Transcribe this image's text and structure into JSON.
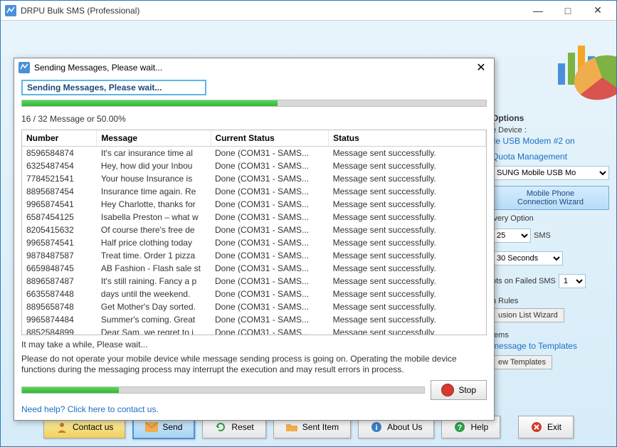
{
  "window": {
    "title": "DRPU Bulk SMS (Professional)",
    "min": "—",
    "max": "□",
    "close": "✕"
  },
  "dialog": {
    "title": "Sending Messages, Please wait...",
    "marquee": "Sending Messages, Please wait...",
    "close": "✕",
    "progress1_pct": "55%",
    "progress_text": "16 / 32 Message or 50.00%",
    "columns": {
      "number": "Number",
      "message": "Message",
      "current": "Current Status",
      "status": "Status"
    },
    "rows": [
      {
        "number": "8596584874",
        "message": "It's car insurance time al",
        "current": "Done (COM31 - SAMS...",
        "status": "Message sent successfully."
      },
      {
        "number": "6325487454",
        "message": "Hey, how did your Inbou",
        "current": "Done (COM31 - SAMS...",
        "status": "Message sent successfully."
      },
      {
        "number": "7784521541",
        "message": "Your house Insurance is",
        "current": "Done (COM31 - SAMS...",
        "status": "Message sent successfully."
      },
      {
        "number": "8895687454",
        "message": "Insurance time again. Re",
        "current": "Done (COM31 - SAMS...",
        "status": "Message sent successfully."
      },
      {
        "number": "9965874541",
        "message": "Hey Charlotte, thanks for",
        "current": "Done (COM31 - SAMS...",
        "status": "Message sent successfully."
      },
      {
        "number": "6587454125",
        "message": "Isabella Preston – what w",
        "current": "Done (COM31 - SAMS...",
        "status": "Message sent successfully."
      },
      {
        "number": "8205415632",
        "message": "Of course there's free de",
        "current": "Done (COM31 - SAMS...",
        "status": "Message sent successfully."
      },
      {
        "number": "9965874541",
        "message": "Half price clothing today",
        "current": "Done (COM31 - SAMS...",
        "status": "Message sent successfully."
      },
      {
        "number": "9878487587",
        "message": "Treat time. Order 1 pizza",
        "current": "Done (COM31 - SAMS...",
        "status": "Message sent successfully."
      },
      {
        "number": "6659848745",
        "message": "AB Fashion - Flash sale st",
        "current": "Done (COM31 - SAMS...",
        "status": "Message sent successfully."
      },
      {
        "number": "8896587487",
        "message": "It's still raining. Fancy a p",
        "current": "Done (COM31 - SAMS...",
        "status": "Message sent successfully."
      },
      {
        "number": "6635587448",
        "message": " days until the weekend.",
        "current": "Done (COM31 - SAMS...",
        "status": "Message sent successfully."
      },
      {
        "number": "8895658748",
        "message": "Get Mother's Day sorted.",
        "current": "Done (COM31 - SAMS...",
        "status": "Message sent successfully."
      },
      {
        "number": "9965874484",
        "message": "Summer's coming. Great",
        "current": "Done (COM31 - SAMS...",
        "status": "Message sent successfully."
      },
      {
        "number": "8852584899",
        "message": "Dear Sam, we regret to i",
        "current": "Done (COM31 - SAMS...",
        "status": "Message sent successfully."
      }
    ],
    "hint": "It may take a while, Please wait...",
    "warning": "Please do not operate your mobile device while message sending process is going on. Operating the mobile device functions during the messaging process may interrupt the execution and may result errors in process.",
    "progress2_pct": "24%",
    "stop_label": "Stop",
    "help_link": "Need help? Click here to contact us."
  },
  "right": {
    "options_title": "Options",
    "device_label": "e Device :",
    "device_link": "ile USB Modem #2 on",
    "quota_link": "Quota Management",
    "device_select": "SUNG Mobile USB Mo",
    "wizard_line1": "Mobile Phone",
    "wizard_line2": "Connection  Wizard",
    "delivery_title": "ivery Option",
    "delivery_count": "25",
    "delivery_unit": "SMS",
    "delay_value": "30 Seconds",
    "failed_label": "ots on Failed SMS",
    "failed_value": "1",
    "rules_label": "n Rules",
    "exclusion_btn": "usion List Wizard",
    "items_label": "tems",
    "templates_link": "message to Templates",
    "view_templates_btn": "ew Templates"
  },
  "toolbar": {
    "contact": "Contact us",
    "send": "Send",
    "reset": "Reset",
    "sent_item": "Sent Item",
    "about": "About Us",
    "help": "Help",
    "exit": "Exit"
  }
}
